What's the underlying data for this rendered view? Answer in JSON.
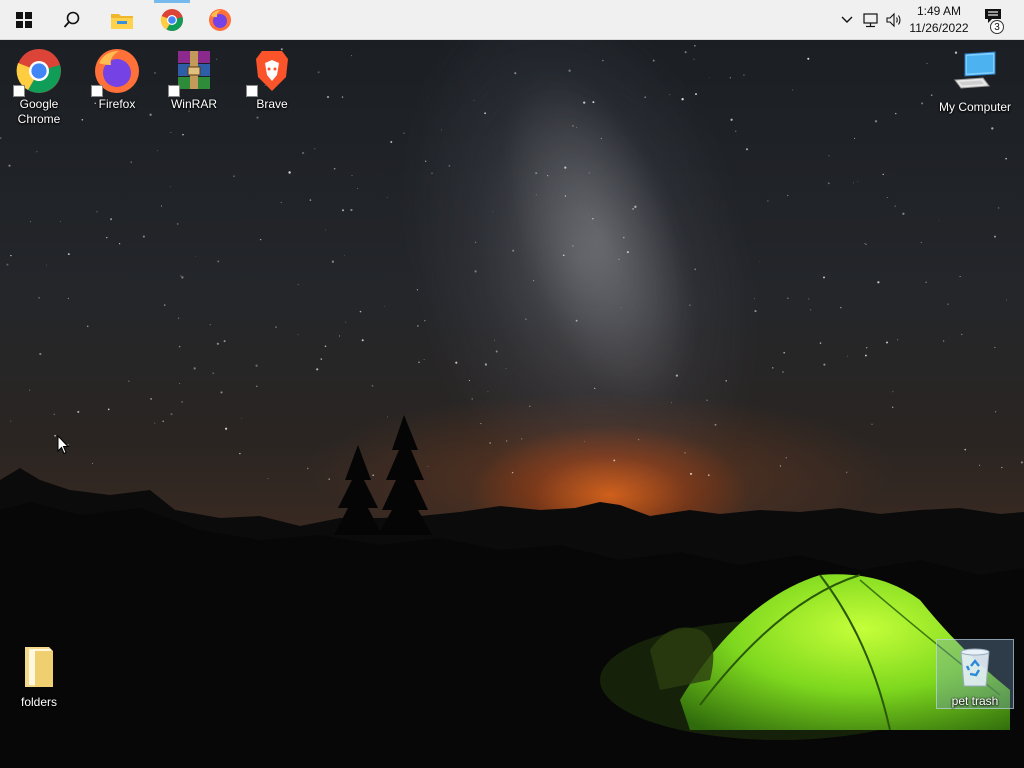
{
  "taskbar": {
    "start_icon": "windows-logo-icon",
    "search_icon": "search-icon",
    "pinned": [
      {
        "name": "File Explorer",
        "icon": "folder-icon"
      },
      {
        "name": "Google Chrome",
        "icon": "chrome-icon",
        "active": true
      },
      {
        "name": "Firefox",
        "icon": "firefox-icon"
      }
    ],
    "tray": {
      "time": "1:49 AM",
      "date": "11/26/2022",
      "notification_count": "3"
    },
    "accent_color": "#76b9ed"
  },
  "desktop": {
    "icons": [
      {
        "label": "Google Chrome",
        "label_lines": [
          "Google",
          "Chrome"
        ],
        "icon": "chrome-icon"
      },
      {
        "label": "Firefox",
        "icon": "firefox-icon"
      },
      {
        "label": "WinRAR",
        "icon": "winrar-icon"
      },
      {
        "label": "Brave",
        "icon": "brave-icon"
      },
      {
        "label": "My Computer",
        "icon": "computer-icon"
      },
      {
        "label": "folders",
        "icon": "folder-icon"
      },
      {
        "label": "pet trash",
        "icon": "recycle-bin-icon",
        "selected": true
      }
    ]
  }
}
